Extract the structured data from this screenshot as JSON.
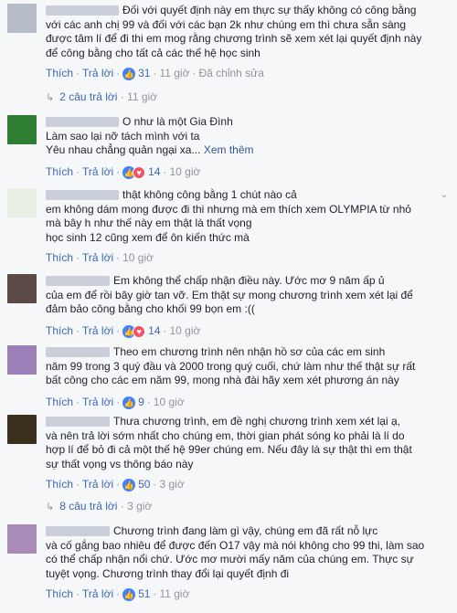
{
  "actions": {
    "like": "Thích",
    "reply": "Trả lời",
    "edit": "Đã chỉnh sửa",
    "sep": "·"
  },
  "comments": [
    {
      "lines": [
        "Đối với quyết định này em thực sự thấy không có công bằng",
        "với các anh chị 99 và đối với các bạn 2k như chúng em thì chưa sẵn sàng",
        "được tâm lí để đi thi em mog rằng chương trình sẽ xem xét lại quyết định này",
        "để công bằng cho tất cả các thế hệ học sinh"
      ],
      "reactions": "31",
      "time": "11 giờ",
      "edited": true,
      "replies_label": "2 câu trả lời",
      "replies_time": "11 giờ"
    },
    {
      "lines": [
        "O như là một Gia Đình",
        "Làm sao lại nỡ tách mình với ta",
        "Yêu nhau chẳng quản ngại xa..."
      ],
      "see_more": "Xem thêm",
      "reactions": "14",
      "time": "10 giờ"
    },
    {
      "lines": [
        "thật không công bằng 1 chút nào cả",
        "em không dám mong được đi thi nhưng mà em thích xem OLYMPIA từ nhỏ",
        "mà bây h như thế này em thật là thất vọng",
        "học sinh 12 cũng xem để ôn kiến thức mà"
      ],
      "reactions": "",
      "time": "10 giờ"
    },
    {
      "lines": [
        "Em không thể chấp nhận điều này. Ước mơ 9 năm ấp ủ",
        "của em để rồi bây giờ tan vỡ. Em thật sự mong chương trình xem xét lại để",
        "đảm bảo công bằng cho khối 99 bọn em :(("
      ],
      "reactions": "14",
      "time": "10 giờ"
    },
    {
      "lines": [
        "Theo em chương trình nên nhận hồ sơ của các em sinh",
        "năm 99 trong 3 quý đầu và 2000 trong quý cuối, chứ làm như thế thật sự rất",
        "bất công cho các em năm 99, mong nhà đài hãy xem xét phương án này"
      ],
      "reactions": "9",
      "time": "10 giờ"
    },
    {
      "lines": [
        "Thưa chương trình, em đề nghị chương trình xem xét lại ạ,",
        "và nên trả lời sớm nhất cho chúng em, thời gian phát sóng ko phải là lí do",
        "hợp lí để bỏ đi cả một thế hệ 99er chúng em. Nếu đây là sự thật thì em thật",
        "sự thất vọng vs thông báo này"
      ],
      "reactions": "50",
      "time": "3 giờ",
      "replies_label": "8 câu trả lời",
      "replies_time": "3 giờ"
    },
    {
      "lines": [
        "Chương trình đang làm gì vậy, chúng em đã rất nỗ lực",
        "và cố gắng bao nhiêu để được đến O17 vậy mà nói không cho 99 thi, làm sao",
        "có thể chấp nhận nổi chứ. Ước mơ mười mấy năm của chúng em. Thực sự",
        "tuyệt vọng. Chương trình thay đổi lại quyết định đi"
      ],
      "reactions": "51",
      "time": "11 giờ"
    }
  ]
}
